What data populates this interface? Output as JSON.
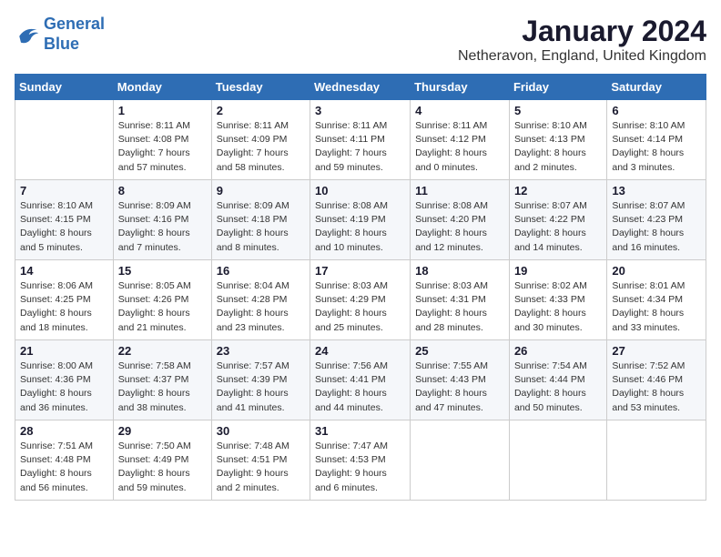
{
  "header": {
    "logo_line1": "General",
    "logo_line2": "Blue",
    "month": "January 2024",
    "location": "Netheravon, England, United Kingdom"
  },
  "weekdays": [
    "Sunday",
    "Monday",
    "Tuesday",
    "Wednesday",
    "Thursday",
    "Friday",
    "Saturday"
  ],
  "weeks": [
    [
      {
        "num": "",
        "info": ""
      },
      {
        "num": "1",
        "info": "Sunrise: 8:11 AM\nSunset: 4:08 PM\nDaylight: 7 hours\nand 57 minutes."
      },
      {
        "num": "2",
        "info": "Sunrise: 8:11 AM\nSunset: 4:09 PM\nDaylight: 7 hours\nand 58 minutes."
      },
      {
        "num": "3",
        "info": "Sunrise: 8:11 AM\nSunset: 4:11 PM\nDaylight: 7 hours\nand 59 minutes."
      },
      {
        "num": "4",
        "info": "Sunrise: 8:11 AM\nSunset: 4:12 PM\nDaylight: 8 hours\nand 0 minutes."
      },
      {
        "num": "5",
        "info": "Sunrise: 8:10 AM\nSunset: 4:13 PM\nDaylight: 8 hours\nand 2 minutes."
      },
      {
        "num": "6",
        "info": "Sunrise: 8:10 AM\nSunset: 4:14 PM\nDaylight: 8 hours\nand 3 minutes."
      }
    ],
    [
      {
        "num": "7",
        "info": "Sunrise: 8:10 AM\nSunset: 4:15 PM\nDaylight: 8 hours\nand 5 minutes."
      },
      {
        "num": "8",
        "info": "Sunrise: 8:09 AM\nSunset: 4:16 PM\nDaylight: 8 hours\nand 7 minutes."
      },
      {
        "num": "9",
        "info": "Sunrise: 8:09 AM\nSunset: 4:18 PM\nDaylight: 8 hours\nand 8 minutes."
      },
      {
        "num": "10",
        "info": "Sunrise: 8:08 AM\nSunset: 4:19 PM\nDaylight: 8 hours\nand 10 minutes."
      },
      {
        "num": "11",
        "info": "Sunrise: 8:08 AM\nSunset: 4:20 PM\nDaylight: 8 hours\nand 12 minutes."
      },
      {
        "num": "12",
        "info": "Sunrise: 8:07 AM\nSunset: 4:22 PM\nDaylight: 8 hours\nand 14 minutes."
      },
      {
        "num": "13",
        "info": "Sunrise: 8:07 AM\nSunset: 4:23 PM\nDaylight: 8 hours\nand 16 minutes."
      }
    ],
    [
      {
        "num": "14",
        "info": "Sunrise: 8:06 AM\nSunset: 4:25 PM\nDaylight: 8 hours\nand 18 minutes."
      },
      {
        "num": "15",
        "info": "Sunrise: 8:05 AM\nSunset: 4:26 PM\nDaylight: 8 hours\nand 21 minutes."
      },
      {
        "num": "16",
        "info": "Sunrise: 8:04 AM\nSunset: 4:28 PM\nDaylight: 8 hours\nand 23 minutes."
      },
      {
        "num": "17",
        "info": "Sunrise: 8:03 AM\nSunset: 4:29 PM\nDaylight: 8 hours\nand 25 minutes."
      },
      {
        "num": "18",
        "info": "Sunrise: 8:03 AM\nSunset: 4:31 PM\nDaylight: 8 hours\nand 28 minutes."
      },
      {
        "num": "19",
        "info": "Sunrise: 8:02 AM\nSunset: 4:33 PM\nDaylight: 8 hours\nand 30 minutes."
      },
      {
        "num": "20",
        "info": "Sunrise: 8:01 AM\nSunset: 4:34 PM\nDaylight: 8 hours\nand 33 minutes."
      }
    ],
    [
      {
        "num": "21",
        "info": "Sunrise: 8:00 AM\nSunset: 4:36 PM\nDaylight: 8 hours\nand 36 minutes."
      },
      {
        "num": "22",
        "info": "Sunrise: 7:58 AM\nSunset: 4:37 PM\nDaylight: 8 hours\nand 38 minutes."
      },
      {
        "num": "23",
        "info": "Sunrise: 7:57 AM\nSunset: 4:39 PM\nDaylight: 8 hours\nand 41 minutes."
      },
      {
        "num": "24",
        "info": "Sunrise: 7:56 AM\nSunset: 4:41 PM\nDaylight: 8 hours\nand 44 minutes."
      },
      {
        "num": "25",
        "info": "Sunrise: 7:55 AM\nSunset: 4:43 PM\nDaylight: 8 hours\nand 47 minutes."
      },
      {
        "num": "26",
        "info": "Sunrise: 7:54 AM\nSunset: 4:44 PM\nDaylight: 8 hours\nand 50 minutes."
      },
      {
        "num": "27",
        "info": "Sunrise: 7:52 AM\nSunset: 4:46 PM\nDaylight: 8 hours\nand 53 minutes."
      }
    ],
    [
      {
        "num": "28",
        "info": "Sunrise: 7:51 AM\nSunset: 4:48 PM\nDaylight: 8 hours\nand 56 minutes."
      },
      {
        "num": "29",
        "info": "Sunrise: 7:50 AM\nSunset: 4:49 PM\nDaylight: 8 hours\nand 59 minutes."
      },
      {
        "num": "30",
        "info": "Sunrise: 7:48 AM\nSunset: 4:51 PM\nDaylight: 9 hours\nand 2 minutes."
      },
      {
        "num": "31",
        "info": "Sunrise: 7:47 AM\nSunset: 4:53 PM\nDaylight: 9 hours\nand 6 minutes."
      },
      {
        "num": "",
        "info": ""
      },
      {
        "num": "",
        "info": ""
      },
      {
        "num": "",
        "info": ""
      }
    ]
  ]
}
